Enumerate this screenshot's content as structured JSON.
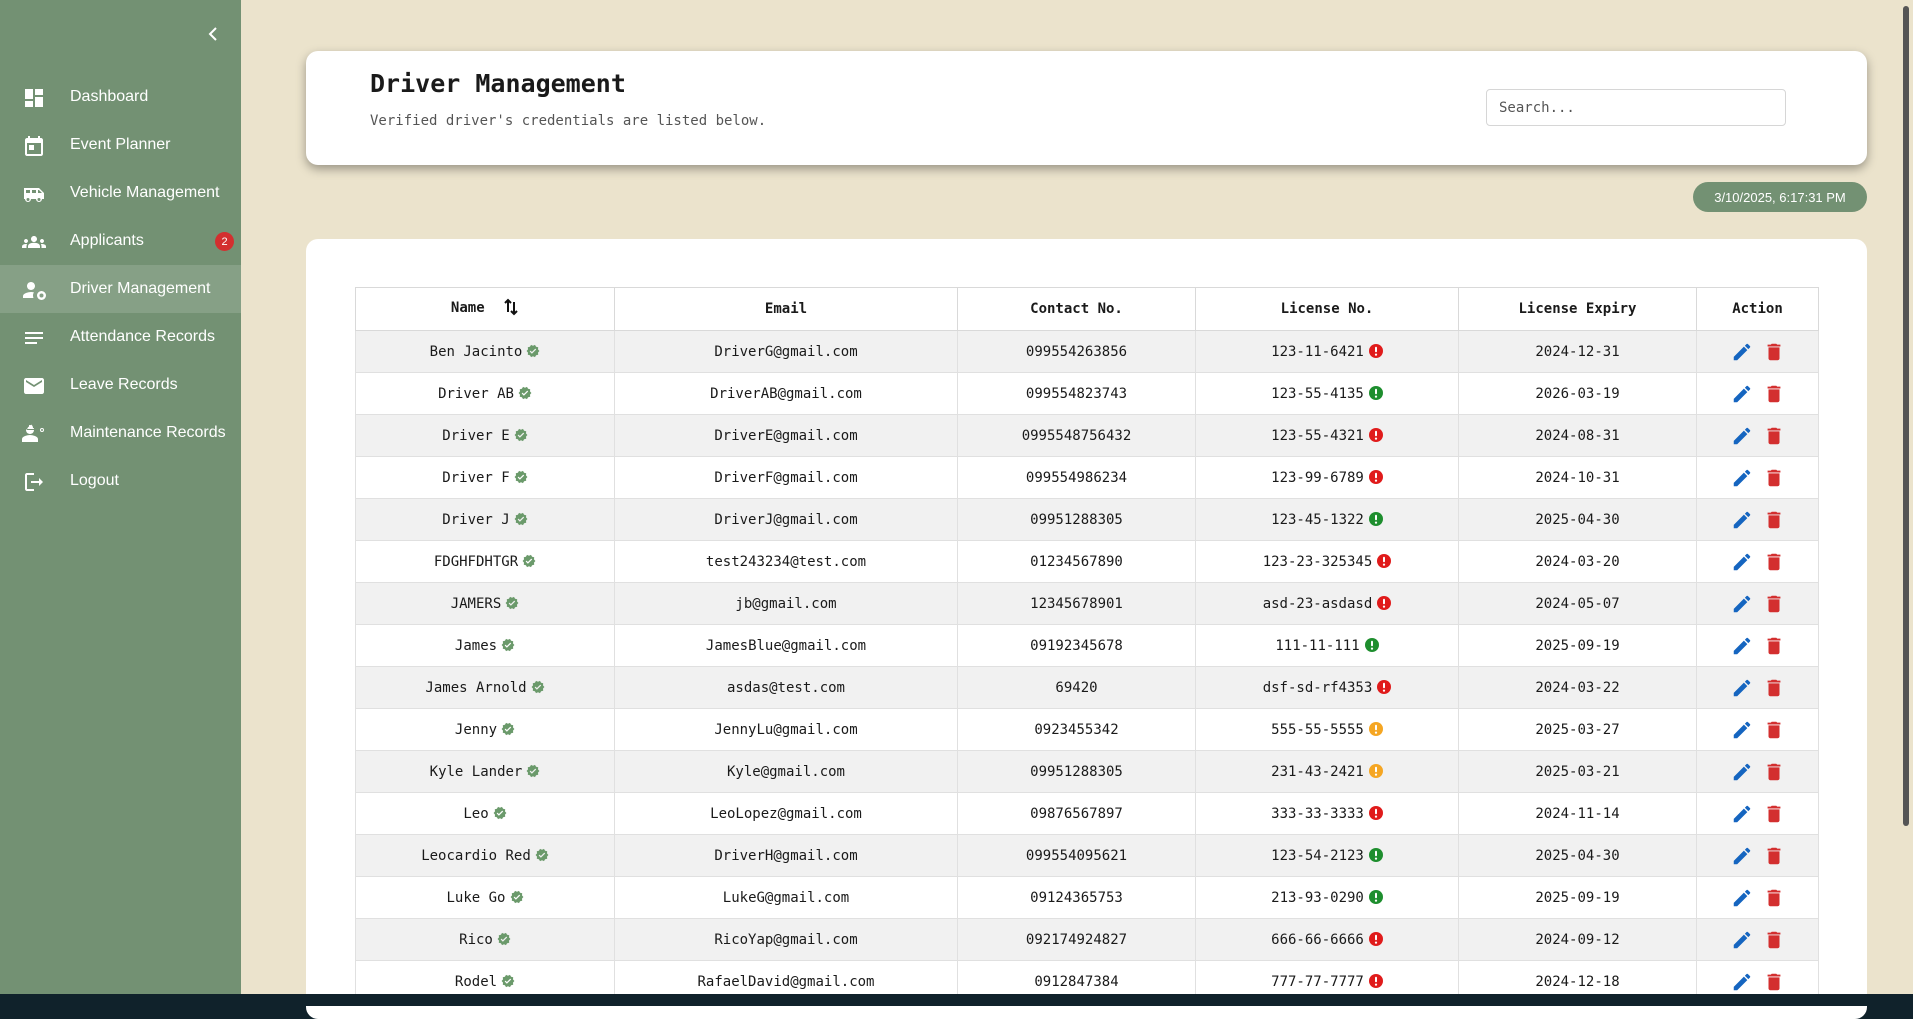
{
  "sidebar": {
    "collapse_icon": "chevron-left-icon",
    "items": [
      {
        "label": "Dashboard",
        "icon": "dashboard-icon",
        "active": false
      },
      {
        "label": "Event Planner",
        "icon": "calendar-icon",
        "active": false
      },
      {
        "label": "Vehicle Management",
        "icon": "bus-icon",
        "active": false
      },
      {
        "label": "Applicants",
        "icon": "people-icon",
        "active": false,
        "badge": "2"
      },
      {
        "label": "Driver Management",
        "icon": "person-gear-icon",
        "active": true
      },
      {
        "label": "Attendance Records",
        "icon": "list-icon",
        "active": false
      },
      {
        "label": "Leave Records",
        "icon": "mail-icon",
        "active": false
      },
      {
        "label": "Maintenance Records",
        "icon": "engineering-icon",
        "active": false
      },
      {
        "label": "Logout",
        "icon": "logout-icon",
        "active": false
      }
    ]
  },
  "header": {
    "title": "Driver Management",
    "subtitle": "Verified driver's credentials are listed below.",
    "search_placeholder": "Search..."
  },
  "timestamp": "3/10/2025, 6:17:31 PM",
  "table": {
    "columns": [
      "Name",
      "Email",
      "Contact No.",
      "License No.",
      "License Expiry",
      "Action"
    ],
    "rows": [
      {
        "name": "Ben Jacinto",
        "email": "DriverG@gmail.com",
        "contact": "099554263856",
        "license": "123-11-6421",
        "status": "expired",
        "expiry": "2024-12-31"
      },
      {
        "name": "Driver AB",
        "email": "DriverAB@gmail.com",
        "contact": "099554823743",
        "license": "123-55-4135",
        "status": "valid",
        "expiry": "2026-03-19"
      },
      {
        "name": "Driver E",
        "email": "DriverE@gmail.com",
        "contact": "0995548756432",
        "license": "123-55-4321",
        "status": "expired",
        "expiry": "2024-08-31"
      },
      {
        "name": "Driver F",
        "email": "DriverF@gmail.com",
        "contact": "099554986234",
        "license": "123-99-6789",
        "status": "expired",
        "expiry": "2024-10-31"
      },
      {
        "name": "Driver J",
        "email": "DriverJ@gmail.com",
        "contact": "09951288305",
        "license": "123-45-1322",
        "status": "valid",
        "expiry": "2025-04-30"
      },
      {
        "name": "FDGHFDHTGR",
        "email": "test243234@test.com",
        "contact": "01234567890",
        "license": "123-23-325345",
        "status": "expired",
        "expiry": "2024-03-20"
      },
      {
        "name": "JAMERS",
        "email": "jb@gmail.com",
        "contact": "12345678901",
        "license": "asd-23-asdasd",
        "status": "expired",
        "expiry": "2024-05-07"
      },
      {
        "name": "James",
        "email": "JamesBlue@gmail.com",
        "contact": "09192345678",
        "license": "111-11-111",
        "status": "valid",
        "expiry": "2025-09-19"
      },
      {
        "name": "James Arnold",
        "email": "asdas@test.com",
        "contact": "69420",
        "license": "dsf-sd-rf4353",
        "status": "expired",
        "expiry": "2024-03-22"
      },
      {
        "name": "Jenny",
        "email": "JennyLu@gmail.com",
        "contact": "0923455342",
        "license": "555-55-5555",
        "status": "expiring",
        "expiry": "2025-03-27"
      },
      {
        "name": "Kyle Lander",
        "email": "Kyle@gmail.com",
        "contact": "09951288305",
        "license": "231-43-2421",
        "status": "expiring",
        "expiry": "2025-03-21"
      },
      {
        "name": "Leo",
        "email": "LeoLopez@gmail.com",
        "contact": "09876567897",
        "license": "333-33-3333",
        "status": "expired",
        "expiry": "2024-11-14"
      },
      {
        "name": "Leocardio Red",
        "email": "DriverH@gmail.com",
        "contact": "099554095621",
        "license": "123-54-2123",
        "status": "valid",
        "expiry": "2025-04-30"
      },
      {
        "name": "Luke Go",
        "email": "LukeG@gmail.com",
        "contact": "09124365753",
        "license": "213-93-0290",
        "status": "valid",
        "expiry": "2025-09-19"
      },
      {
        "name": "Rico",
        "email": "RicoYap@gmail.com",
        "contact": "092174924827",
        "license": "666-66-6666",
        "status": "expired",
        "expiry": "2024-09-12"
      },
      {
        "name": "Rodel",
        "email": "RafaelDavid@gmail.com",
        "contact": "0912847384",
        "license": "777-77-7777",
        "status": "expired",
        "expiry": "2024-12-18"
      }
    ]
  },
  "colors": {
    "sidebar": "#739173",
    "sidebar_active": "#86a086",
    "background": "#ebe3cc",
    "verified": "#6b9a6b",
    "status_valid": "#1e8e2e",
    "status_expired": "#e01b1b",
    "status_expiring": "#f5a623",
    "edit": "#1565c0",
    "delete": "#d32f2f"
  }
}
